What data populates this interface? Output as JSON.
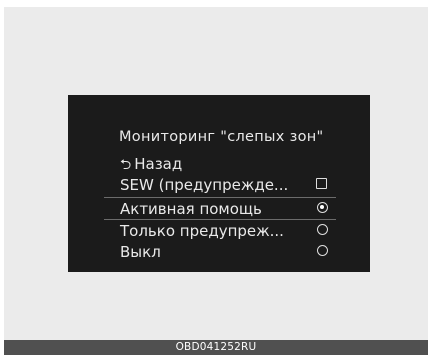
{
  "menu": {
    "title": "Мониторинг \"слепых зон\"",
    "back_icon": "return-arrow-icon",
    "back_label": "Назад",
    "items": [
      {
        "label": "SEW (предупрежде...",
        "control": "checkbox",
        "checked": false
      },
      {
        "label": "Активная помощь",
        "control": "radio",
        "checked": true,
        "selected": true
      },
      {
        "label": "Только предупреж...",
        "control": "radio",
        "checked": false
      },
      {
        "label": "Выкл",
        "control": "radio",
        "checked": false
      }
    ]
  },
  "caption": "OBD041252RU",
  "colors": {
    "screen": "#1b1b1b",
    "text": "#e9e9e9",
    "background": "#ebebeb",
    "caption_bar": "#505050"
  }
}
